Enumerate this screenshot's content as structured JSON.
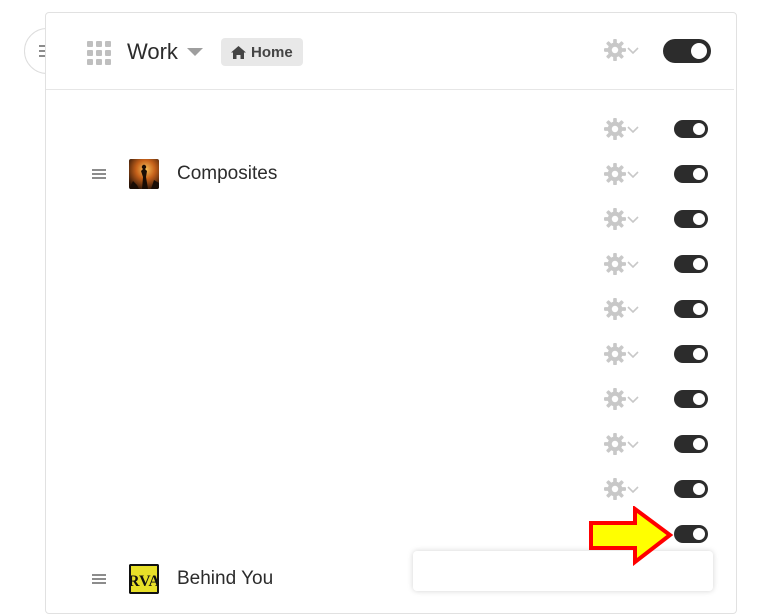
{
  "header": {
    "workspace_title": "Work",
    "home_label": "Home",
    "header_toggle_on": true
  },
  "rows": [
    {
      "kind": "setting",
      "toggle_on": true
    },
    {
      "kind": "item",
      "label": "Composites",
      "thumb": "composites-thumbnail",
      "toggle_on": true
    },
    {
      "kind": "setting",
      "toggle_on": true
    },
    {
      "kind": "setting",
      "toggle_on": true
    },
    {
      "kind": "setting",
      "toggle_on": true
    },
    {
      "kind": "setting",
      "toggle_on": true
    },
    {
      "kind": "setting",
      "toggle_on": true
    },
    {
      "kind": "setting",
      "toggle_on": true
    },
    {
      "kind": "setting",
      "toggle_on": true
    },
    {
      "kind": "setting",
      "toggle_on": true
    },
    {
      "kind": "item",
      "label": "Behind You",
      "thumb": "rva-thumbnail",
      "thumb_text": "RVA",
      "toggle_on": false
    }
  ],
  "colors": {
    "toggle_on": "#2c2c2c",
    "toggle_off": "#d6d6d6",
    "gear": "#c8c8c8",
    "arrow_fill": "#ffff00",
    "arrow_stroke": "#ff0000"
  },
  "icons": {
    "menu": "hamburger-icon",
    "apps": "grid-icon",
    "home": "home-icon",
    "settings": "gear-icon",
    "dropdown": "chevron-down-icon",
    "drag": "drag-handle-icon",
    "annotation": "arrow-right-icon"
  }
}
